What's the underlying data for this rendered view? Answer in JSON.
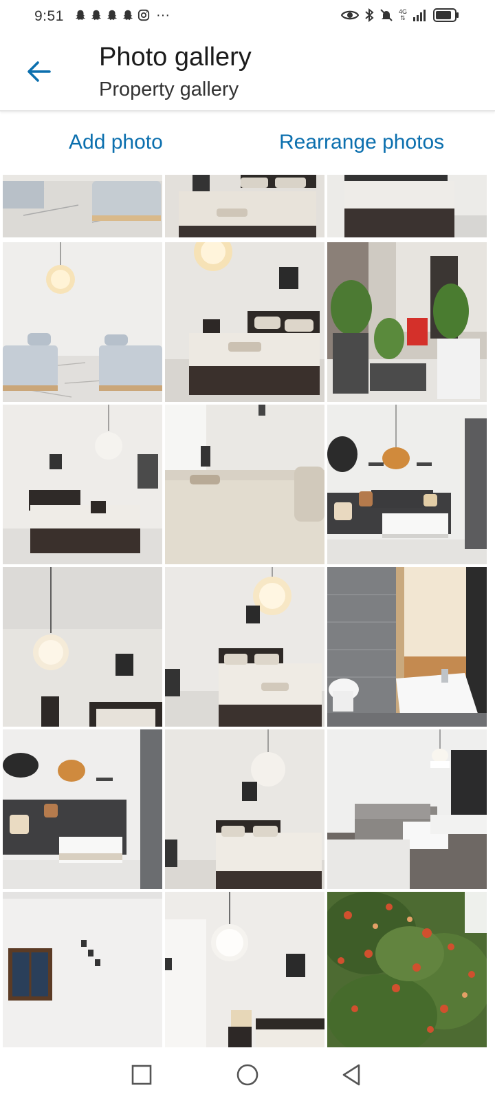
{
  "status": {
    "time": "9:51",
    "notif_dots": "···",
    "network": "4G",
    "icons": [
      "snapchat-icon",
      "snapchat-icon",
      "snapchat-icon",
      "snapchat-icon",
      "instagram-icon",
      "eye-icon",
      "bluetooth-icon",
      "mute-icon",
      "signal-icon",
      "battery-icon"
    ]
  },
  "header": {
    "title": "Photo gallery",
    "subtitle": "Property gallery"
  },
  "actions": {
    "add_photo": "Add photo",
    "rearrange": "Rearrange photos"
  },
  "gallery": {
    "photos": [
      {
        "scene": "twin-beds"
      },
      {
        "scene": "double-bed"
      },
      {
        "scene": "double-bed-corner"
      },
      {
        "scene": "twin-beds-lamp"
      },
      {
        "scene": "double-bed-lamp"
      },
      {
        "scene": "plants-terrace"
      },
      {
        "scene": "bedroom-wide"
      },
      {
        "scene": "bed-closeup"
      },
      {
        "scene": "living-room"
      },
      {
        "scene": "lamp-room"
      },
      {
        "scene": "bedroom-lamp"
      },
      {
        "scene": "bathroom"
      },
      {
        "scene": "living-room-2"
      },
      {
        "scene": "bedroom-lamp-2"
      },
      {
        "scene": "lounge"
      },
      {
        "scene": "window-wall"
      },
      {
        "scene": "bedroom-lamp-3"
      },
      {
        "scene": "orange-tree"
      }
    ]
  },
  "colors": {
    "accent": "#0b6fae",
    "text": "#1b1b1b"
  },
  "navbar": {
    "icons": [
      "recents-square-icon",
      "home-circle-icon",
      "back-triangle-icon"
    ]
  }
}
